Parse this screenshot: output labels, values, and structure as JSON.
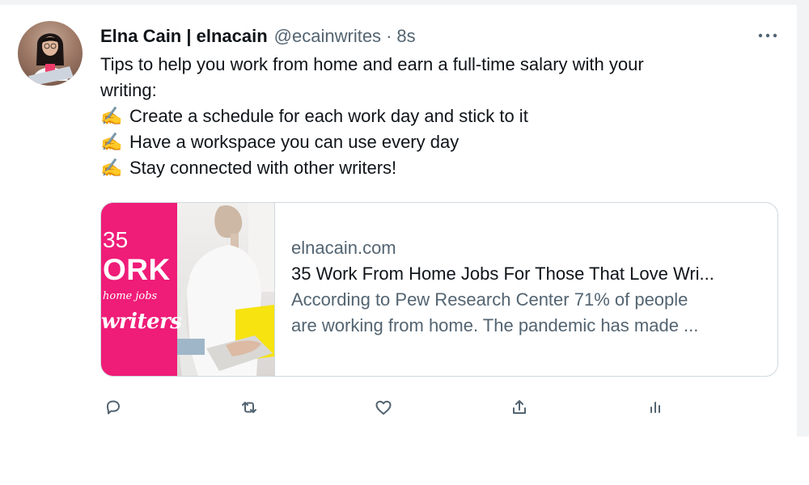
{
  "tweet": {
    "author_name": "Elna Cain | elnacain",
    "author_handle": "@ecainwrites",
    "dot": "·",
    "time": "8s",
    "text_lines": [
      "Tips to help you work from home and earn a full-time salary with your",
      "writing:"
    ],
    "bullets": [
      {
        "emoji": "✍️",
        "text": "Create a schedule for each work day and stick to it"
      },
      {
        "emoji": "✍️",
        "text": "Have a workspace you can use every day"
      },
      {
        "emoji": "✍️",
        "text": "Stay connected with other writers!"
      }
    ]
  },
  "card": {
    "domain": "elnacain.com",
    "title": "35 Work From Home Jobs For Those That Love Wri...",
    "description_lines": [
      "According to Pew Research Center 71% of people",
      "are working from home. The pandemic has made ..."
    ],
    "thumbnail_lines": {
      "number": "35",
      "word": "ORK",
      "subtitle": "home jobs",
      "script": "writers"
    }
  },
  "actions": {
    "reply_icon": "reply-icon",
    "retweet_icon": "retweet-icon",
    "like_icon": "heart-icon",
    "share_icon": "share-icon",
    "analytics_icon": "analytics-icon"
  },
  "colors": {
    "primary_text": "#0f1419",
    "secondary_text": "#536471",
    "card_border": "#cfd9de",
    "thumbnail_pink": "#ef1c78"
  }
}
